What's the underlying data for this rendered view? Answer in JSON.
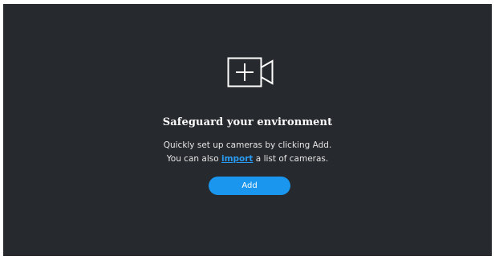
{
  "empty_state": {
    "icon": "video-camera-plus-icon",
    "title": "Safeguard your environment",
    "line1": "Quickly set up cameras by clicking Add.",
    "line2_prefix": "You can also ",
    "import_link": "import",
    "line2_suffix": " a list of cameras.",
    "add_button": "Add"
  },
  "colors": {
    "panel_background": "#26292d",
    "accent": "#1a96ee",
    "link": "#2a9bf2"
  }
}
